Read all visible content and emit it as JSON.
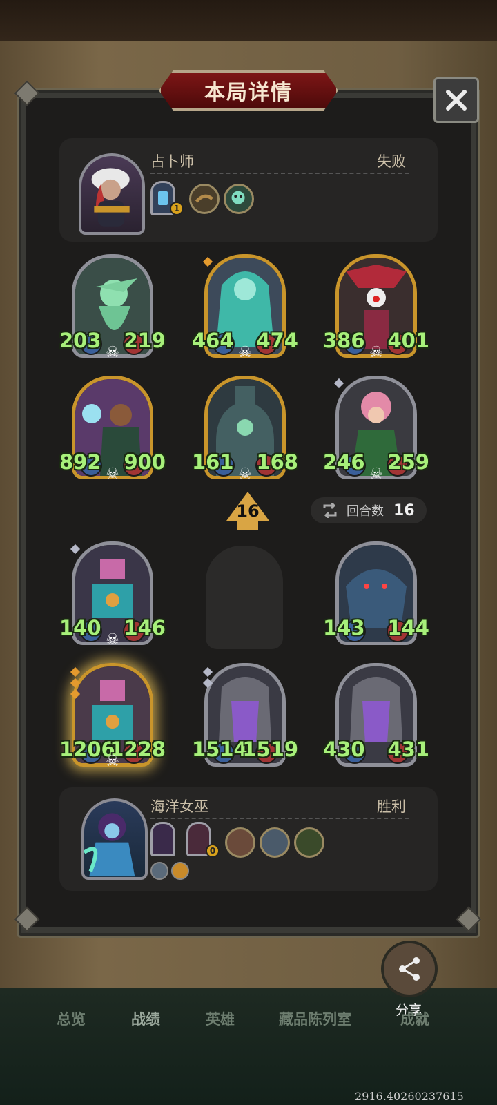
{
  "title": "本局详情",
  "opponent": {
    "name": "占卜师",
    "result": "失败",
    "badge": "1"
  },
  "player": {
    "name": "海洋女巫",
    "result": "胜利",
    "badge": "0"
  },
  "enemy_cards": [
    {
      "atk": "203",
      "hp": "219",
      "frame": "silver"
    },
    {
      "atk": "464",
      "hp": "474",
      "frame": "gold"
    },
    {
      "atk": "386",
      "hp": "401",
      "frame": "gold"
    },
    {
      "atk": "892",
      "hp": "900",
      "frame": "gold"
    },
    {
      "atk": "161",
      "hp": "168",
      "frame": "gold"
    },
    {
      "atk": "246",
      "hp": "259",
      "frame": "silver"
    }
  ],
  "player_cards": [
    {
      "atk": "140",
      "hp": "146",
      "frame": "silver"
    },
    {
      "atk": "143",
      "hp": "144",
      "frame": "silver"
    },
    {
      "atk": "1206",
      "hp": "1228",
      "frame": "gold"
    },
    {
      "atk": "1514",
      "hp": "1519",
      "frame": "silver"
    },
    {
      "atk": "430",
      "hp": "431",
      "frame": "silver"
    }
  ],
  "round_marker": "16",
  "round_label": "回合数",
  "round_count": "16",
  "nav": {
    "overview": "总览",
    "records": "战绩",
    "heroes": "英雄",
    "collection": "藏品陈列室",
    "achievements": "成就"
  },
  "share_label": "分享",
  "version": "2916.40260237615",
  "colors": {
    "stat_green": "#a7f07a",
    "title_red": "#7d1616",
    "gold_frame": "#c9952b"
  },
  "icons": [
    "close-icon",
    "skull-icon",
    "swap-icon",
    "share-icon"
  ]
}
